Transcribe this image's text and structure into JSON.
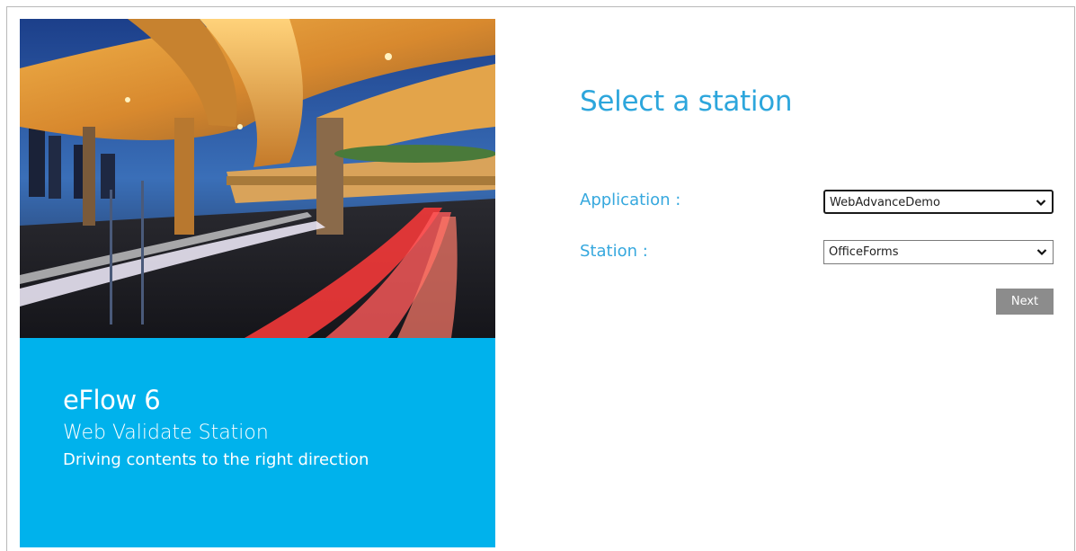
{
  "brand": {
    "title": "eFlow 6",
    "subtitle": "Web Validate Station",
    "tagline": "Driving contents to the right direction"
  },
  "form": {
    "title": "Select a station",
    "application": {
      "label": "Application :",
      "value": "WebAdvanceDemo"
    },
    "station": {
      "label": "Station :",
      "value": "OfficeForms"
    },
    "next_label": "Next"
  },
  "colors": {
    "brand_blue": "#00b2ec",
    "title_blue": "#2da6dc",
    "label_blue": "#36a8de",
    "button_gray": "#8c8c8c"
  },
  "icons": {
    "dropdown": "chevron-down-icon"
  }
}
